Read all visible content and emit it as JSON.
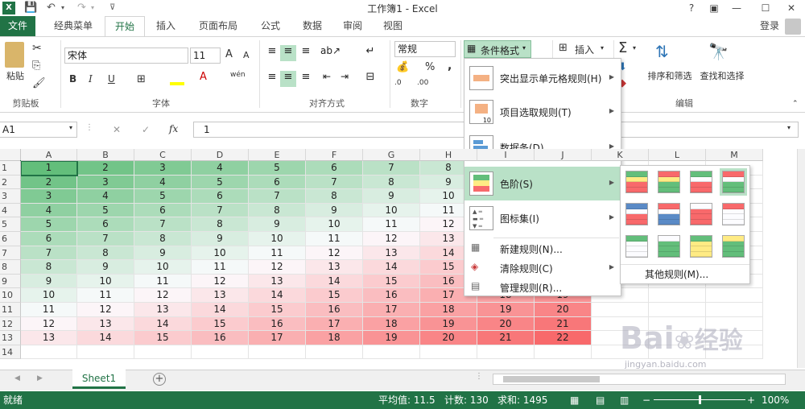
{
  "titlebar": {
    "app_icon": "X",
    "title": "工作簿1 - Excel",
    "help": "?"
  },
  "tabs": {
    "file": "文件",
    "items": [
      "经典菜单",
      "开始",
      "插入",
      "页面布局",
      "公式",
      "数据",
      "审阅",
      "视图"
    ],
    "login": "登录"
  },
  "ribbon": {
    "clipboard": {
      "paste": "粘贴",
      "label": "剪贴板"
    },
    "font": {
      "name": "宋体",
      "size": "11",
      "label": "字体",
      "bold": "B",
      "italic": "I",
      "underline": "U",
      "grow": "A",
      "shrink": "A",
      "wen": "wén"
    },
    "alignment": {
      "label": "对齐方式"
    },
    "number": {
      "format": "常规",
      "percent": "%",
      "comma": ",",
      "label": "数字",
      "inc": ".00",
      "dec": ".0"
    },
    "styles": {
      "conditional": "条件格式"
    },
    "cells": {
      "insert": "插入"
    },
    "editing": {
      "sort": "排序和筛选",
      "find": "查找和选择",
      "label": "编辑",
      "sum": "Σ"
    }
  },
  "formula_bar": {
    "name_box": "A1",
    "cancel": "✕",
    "enter": "✓",
    "fx": "fx",
    "value": "1"
  },
  "grid": {
    "columns": [
      "A",
      "B",
      "C",
      "D",
      "E",
      "F",
      "G",
      "H",
      "I",
      "J",
      "K",
      "L",
      "M"
    ],
    "rows": [
      "1",
      "2",
      "3",
      "4",
      "5",
      "6",
      "7",
      "8",
      "9",
      "10",
      "11",
      "12",
      "13",
      "14"
    ]
  },
  "conditional_menu": {
    "items": [
      {
        "label": "突出显示单元格规则(H)",
        "icon": "highlight-rules-icon"
      },
      {
        "label": "项目选取规则(T)",
        "icon": "top-bottom-rules-icon"
      },
      {
        "label": "数据条(D)",
        "icon": "data-bars-icon"
      },
      {
        "label": "色阶(S)",
        "icon": "color-scales-icon"
      },
      {
        "label": "图标集(I)",
        "icon": "icon-sets-icon"
      }
    ],
    "small_items": [
      {
        "label": "新建规则(N)...",
        "icon": "new-rule-icon"
      },
      {
        "label": "清除规则(C)",
        "icon": "clear-rules-icon"
      },
      {
        "label": "管理规则(R)...",
        "icon": "manage-rules-icon"
      }
    ]
  },
  "color_scale_menu": {
    "swatches": [
      [
        "#63be7b",
        "#ffeb84",
        "#f8696b"
      ],
      [
        "#f8696b",
        "#ffeb84",
        "#63be7b"
      ],
      [
        "#63be7b",
        "#fcfcff",
        "#f8696b"
      ],
      [
        "#f8696b",
        "#fcfcff",
        "#63be7b"
      ],
      [
        "#5a8ac6",
        "#fcfcff",
        "#f8696b"
      ],
      [
        "#f8696b",
        "#fcfcff",
        "#5a8ac6"
      ],
      [
        "#fcfcff",
        "#f8696b",
        "#f8696b"
      ],
      [
        "#f8696b",
        "#fcfcff",
        "#fcfcff"
      ],
      [
        "#63be7b",
        "#fcfcff",
        "#fcfcff"
      ],
      [
        "#fcfcff",
        "#63be7b",
        "#63be7b"
      ],
      [
        "#63be7b",
        "#ffeb84",
        "#ffeb84"
      ],
      [
        "#ffeb84",
        "#63be7b",
        "#63be7b"
      ]
    ],
    "more": "其他规则(M)..."
  },
  "sheets": {
    "active": "Sheet1",
    "add": "+"
  },
  "status": {
    "ready": "就绪",
    "average": "平均值: 11.5",
    "count": "计数: 130",
    "sum": "求和: 1495",
    "zoom": "100%"
  },
  "watermark": {
    "logo": "Bai",
    "logo2": "经验",
    "url": "jingyan.baidu.com"
  },
  "colors": {
    "accent": "#217346",
    "scale_low": "#63be7b",
    "scale_mid": "#fcfcff",
    "scale_high": "#f8696b"
  }
}
